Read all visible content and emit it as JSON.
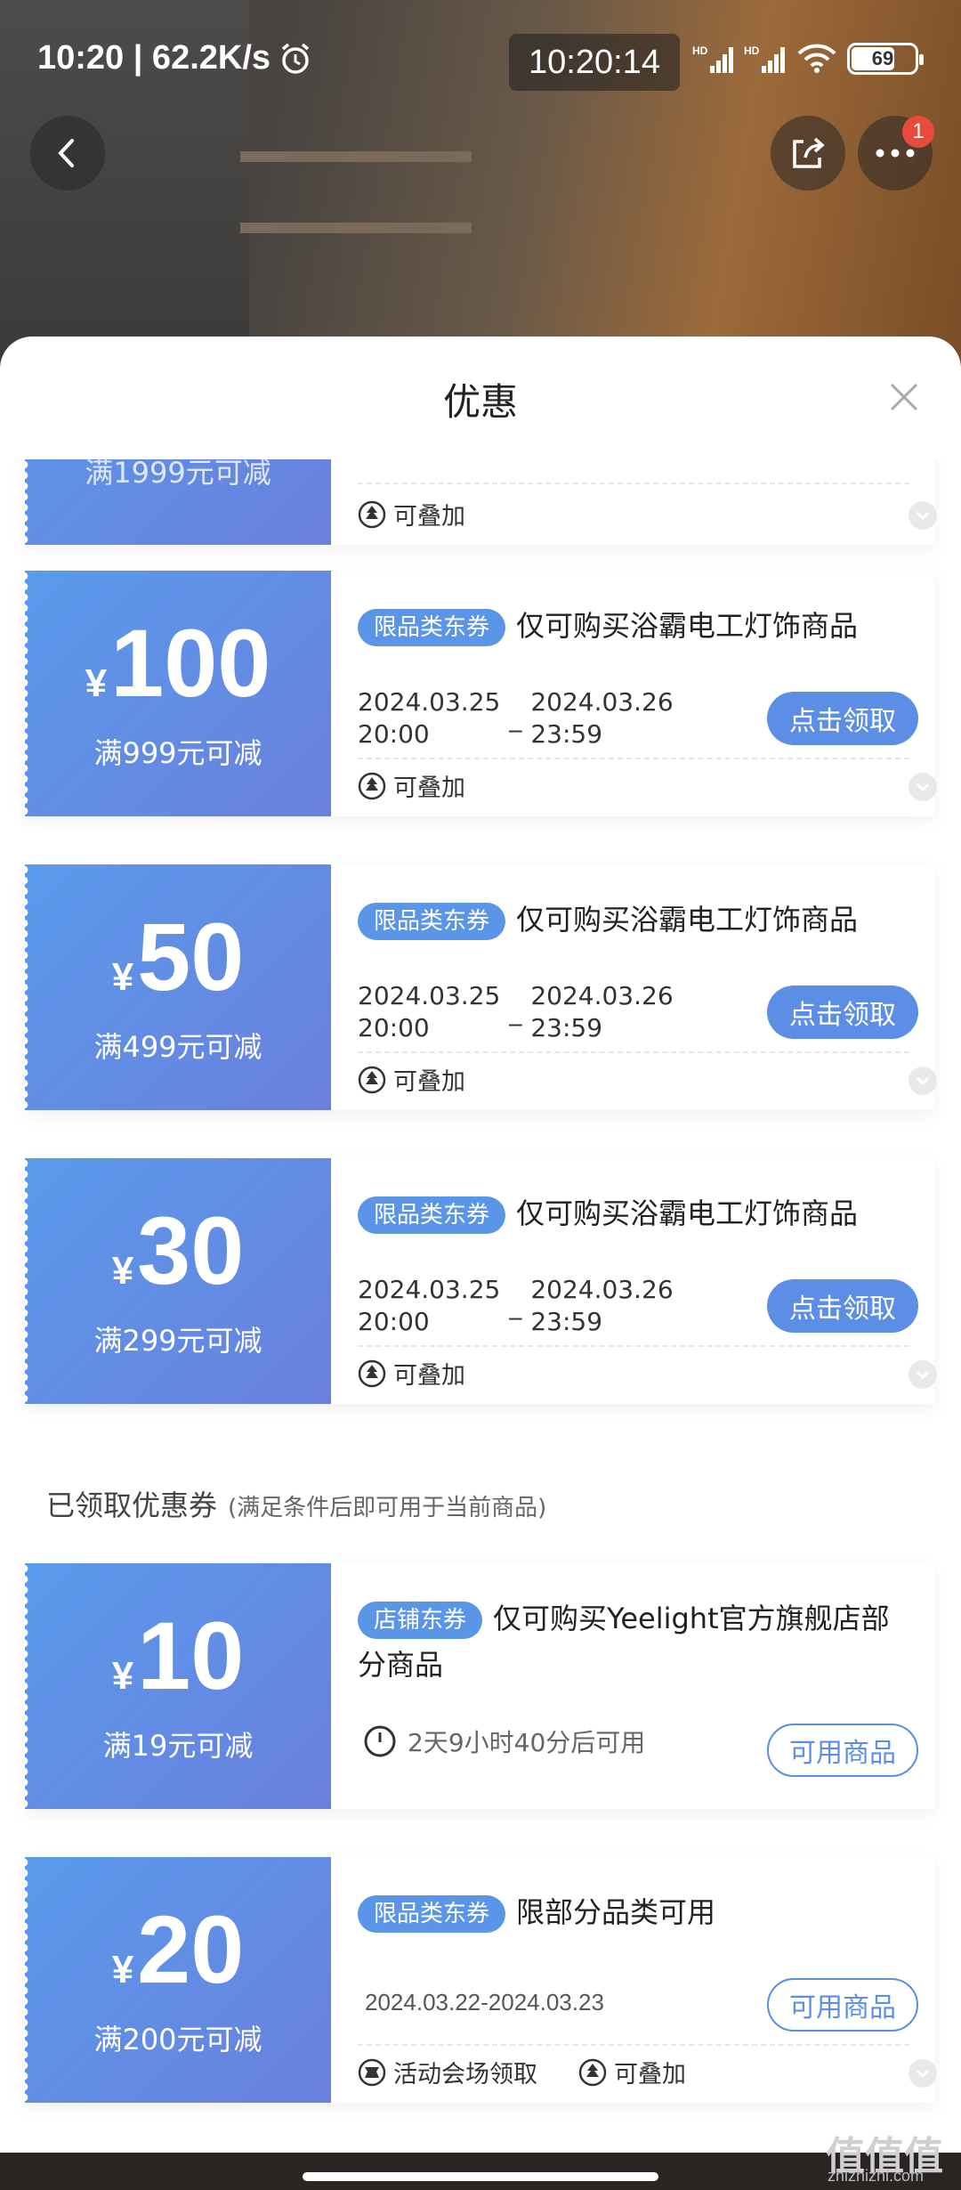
{
  "status_bar": {
    "time_speed": "10:20 | 62.2K/s",
    "clock_box": "10:20:14",
    "battery": "69",
    "hd1": "HD",
    "hd2": "HD"
  },
  "sheet": {
    "title": "优惠"
  },
  "partial_top": {
    "min_spend": "满1999元可减",
    "stack_label": "可叠加"
  },
  "coupons": [
    {
      "yen": "¥",
      "amount": "100",
      "min_spend": "满999元可减",
      "tag": "限品类东券",
      "title": "仅可购买浴霸电工灯饰商品",
      "date_start": "2024.03.25\n20:00",
      "date_sep": "_",
      "date_end": "2024.03.26\n23:59",
      "button": "点击领取",
      "stack_label": "可叠加"
    },
    {
      "yen": "¥",
      "amount": "50",
      "min_spend": "满499元可减",
      "tag": "限品类东券",
      "title": "仅可购买浴霸电工灯饰商品",
      "date_start": "2024.03.25\n20:00",
      "date_sep": "_",
      "date_end": "2024.03.26\n23:59",
      "button": "点击领取",
      "stack_label": "可叠加"
    },
    {
      "yen": "¥",
      "amount": "30",
      "min_spend": "满299元可减",
      "tag": "限品类东券",
      "title": "仅可购买浴霸电工灯饰商品",
      "date_start": "2024.03.25\n20:00",
      "date_sep": "_",
      "date_end": "2024.03.26\n23:59",
      "button": "点击领取",
      "stack_label": "可叠加"
    }
  ],
  "claimed_section": {
    "title": "已领取优惠券",
    "note": "(满足条件后即可用于当前商品)"
  },
  "claimed": [
    {
      "yen": "¥",
      "amount": "10",
      "min_spend": "满19元可减",
      "tag": "店铺东券",
      "title": "仅可购买Yeelight官方旗舰店部分商品",
      "availability": "2天9小时40分后可用",
      "button": "可用商品"
    },
    {
      "yen": "¥",
      "amount": "20",
      "min_spend": "满200元可减",
      "tag": "限品类东券",
      "title": "限部分品类可用",
      "date_range": "2024.03.22-2024.03.23",
      "button": "可用商品",
      "venue_label": "活动会场领取",
      "stack_label": "可叠加"
    }
  ],
  "badge_count": "1",
  "watermark": {
    "main": "值值值",
    "sub": "zhizhizhi.com"
  }
}
